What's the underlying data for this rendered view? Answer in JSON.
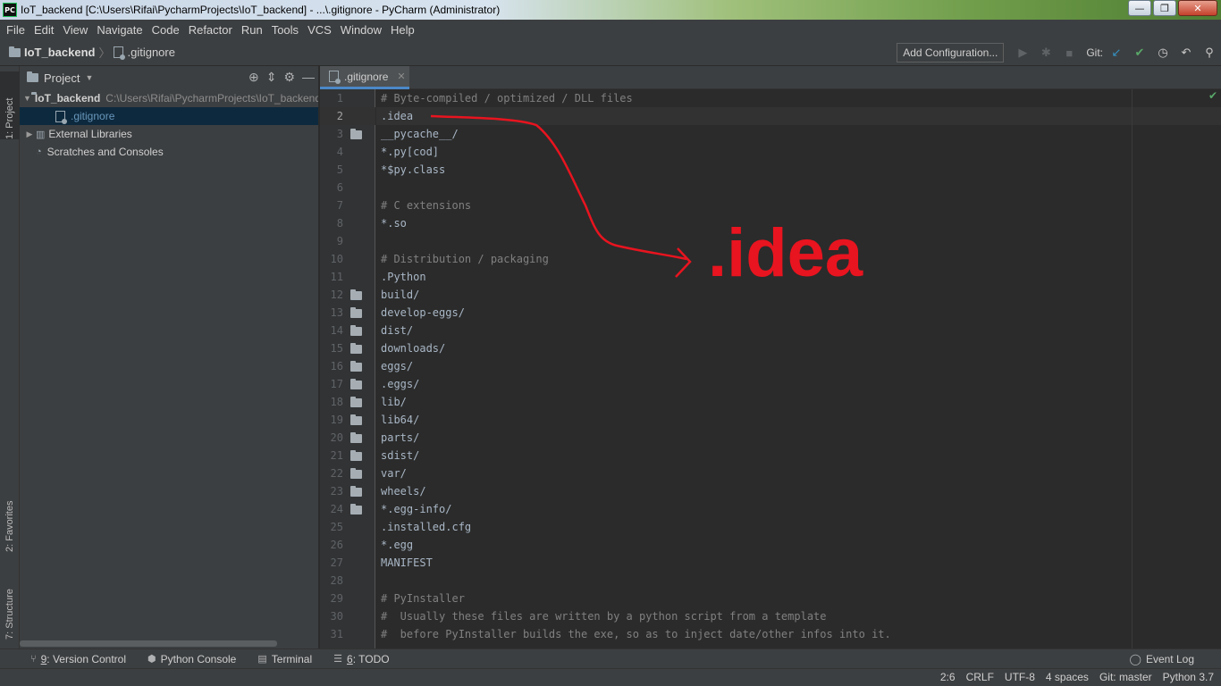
{
  "window": {
    "app_icon": "PC",
    "title": "IoT_backend [C:\\Users\\Rifai\\PycharmProjects\\IoT_backend] - ...\\.gitignore - PyCharm (Administrator)",
    "minimize": "—",
    "maximize": "❐",
    "close": "✕"
  },
  "menu": [
    "File",
    "Edit",
    "View",
    "Navigate",
    "Code",
    "Refactor",
    "Run",
    "Tools",
    "VCS",
    "Window",
    "Help"
  ],
  "navbar": {
    "project": "IoT_backend",
    "file": ".gitignore",
    "add_configuration": "Add Configuration...",
    "git_label": "Git:"
  },
  "left_stripe": {
    "project_tab": "1: Project",
    "favorites_tab": "2: Favorites",
    "structure_tab": "7: Structure"
  },
  "project_panel": {
    "title": "Project",
    "root_name": "IoT_backend",
    "root_path": "C:\\Users\\Rifai\\PycharmProjects\\IoT_backend",
    "file": ".gitignore",
    "external": "External Libraries",
    "scratches": "Scratches and Consoles"
  },
  "editor": {
    "tab_label": ".gitignore",
    "lines": [
      {
        "n": "1",
        "text": "# Byte-compiled / optimized / DLL files",
        "comment": true,
        "folder": false
      },
      {
        "n": "2",
        "text": ".idea",
        "comment": false,
        "folder": false
      },
      {
        "n": "3",
        "text": "__pycache__/",
        "comment": false,
        "folder": true
      },
      {
        "n": "4",
        "text": "*.py[cod]",
        "comment": false,
        "folder": false
      },
      {
        "n": "5",
        "text": "*$py.class",
        "comment": false,
        "folder": false
      },
      {
        "n": "6",
        "text": "",
        "comment": false,
        "folder": false
      },
      {
        "n": "7",
        "text": "# C extensions",
        "comment": true,
        "folder": false
      },
      {
        "n": "8",
        "text": "*.so",
        "comment": false,
        "folder": false
      },
      {
        "n": "9",
        "text": "",
        "comment": false,
        "folder": false
      },
      {
        "n": "10",
        "text": "# Distribution / packaging",
        "comment": true,
        "folder": false
      },
      {
        "n": "11",
        "text": ".Python",
        "comment": false,
        "folder": false
      },
      {
        "n": "12",
        "text": "build/",
        "comment": false,
        "folder": true
      },
      {
        "n": "13",
        "text": "develop-eggs/",
        "comment": false,
        "folder": true
      },
      {
        "n": "14",
        "text": "dist/",
        "comment": false,
        "folder": true
      },
      {
        "n": "15",
        "text": "downloads/",
        "comment": false,
        "folder": true
      },
      {
        "n": "16",
        "text": "eggs/",
        "comment": false,
        "folder": true
      },
      {
        "n": "17",
        "text": ".eggs/",
        "comment": false,
        "folder": true
      },
      {
        "n": "18",
        "text": "lib/",
        "comment": false,
        "folder": true
      },
      {
        "n": "19",
        "text": "lib64/",
        "comment": false,
        "folder": true
      },
      {
        "n": "20",
        "text": "parts/",
        "comment": false,
        "folder": true
      },
      {
        "n": "21",
        "text": "sdist/",
        "comment": false,
        "folder": true
      },
      {
        "n": "22",
        "text": "var/",
        "comment": false,
        "folder": true
      },
      {
        "n": "23",
        "text": "wheels/",
        "comment": false,
        "folder": true
      },
      {
        "n": "24",
        "text": "*.egg-info/",
        "comment": false,
        "folder": true
      },
      {
        "n": "25",
        "text": ".installed.cfg",
        "comment": false,
        "folder": false
      },
      {
        "n": "26",
        "text": "*.egg",
        "comment": false,
        "folder": false
      },
      {
        "n": "27",
        "text": "MANIFEST",
        "comment": false,
        "folder": false
      },
      {
        "n": "28",
        "text": "",
        "comment": false,
        "folder": false
      },
      {
        "n": "29",
        "text": "# PyInstaller",
        "comment": true,
        "folder": false
      },
      {
        "n": "30",
        "text": "#  Usually these files are written by a python script from a template",
        "comment": true,
        "folder": false
      },
      {
        "n": "31",
        "text": "#  before PyInstaller builds the exe, so as to inject date/other infos into it.",
        "comment": true,
        "folder": false
      }
    ],
    "current_line": 2
  },
  "annotation": {
    "text": ".idea",
    "color": "#e8141f"
  },
  "bottom_tools": [
    {
      "key": "9",
      "label": ": Version Control"
    },
    {
      "key": "",
      "label": "Python Console"
    },
    {
      "key": "",
      "label": "Terminal"
    },
    {
      "key": "6",
      "label": ": TODO"
    }
  ],
  "event_log": "Event Log",
  "status": {
    "position": "2:6",
    "line_sep": "CRLF",
    "encoding": "UTF-8",
    "indent": "4 spaces",
    "branch": "Git: master",
    "interpreter": "Python 3.7"
  },
  "colors": {
    "accent": "#4a88c7",
    "bg": "#2b2b2b",
    "panel": "#3c3f41",
    "comment": "#808080",
    "text": "#a9b7c6"
  }
}
